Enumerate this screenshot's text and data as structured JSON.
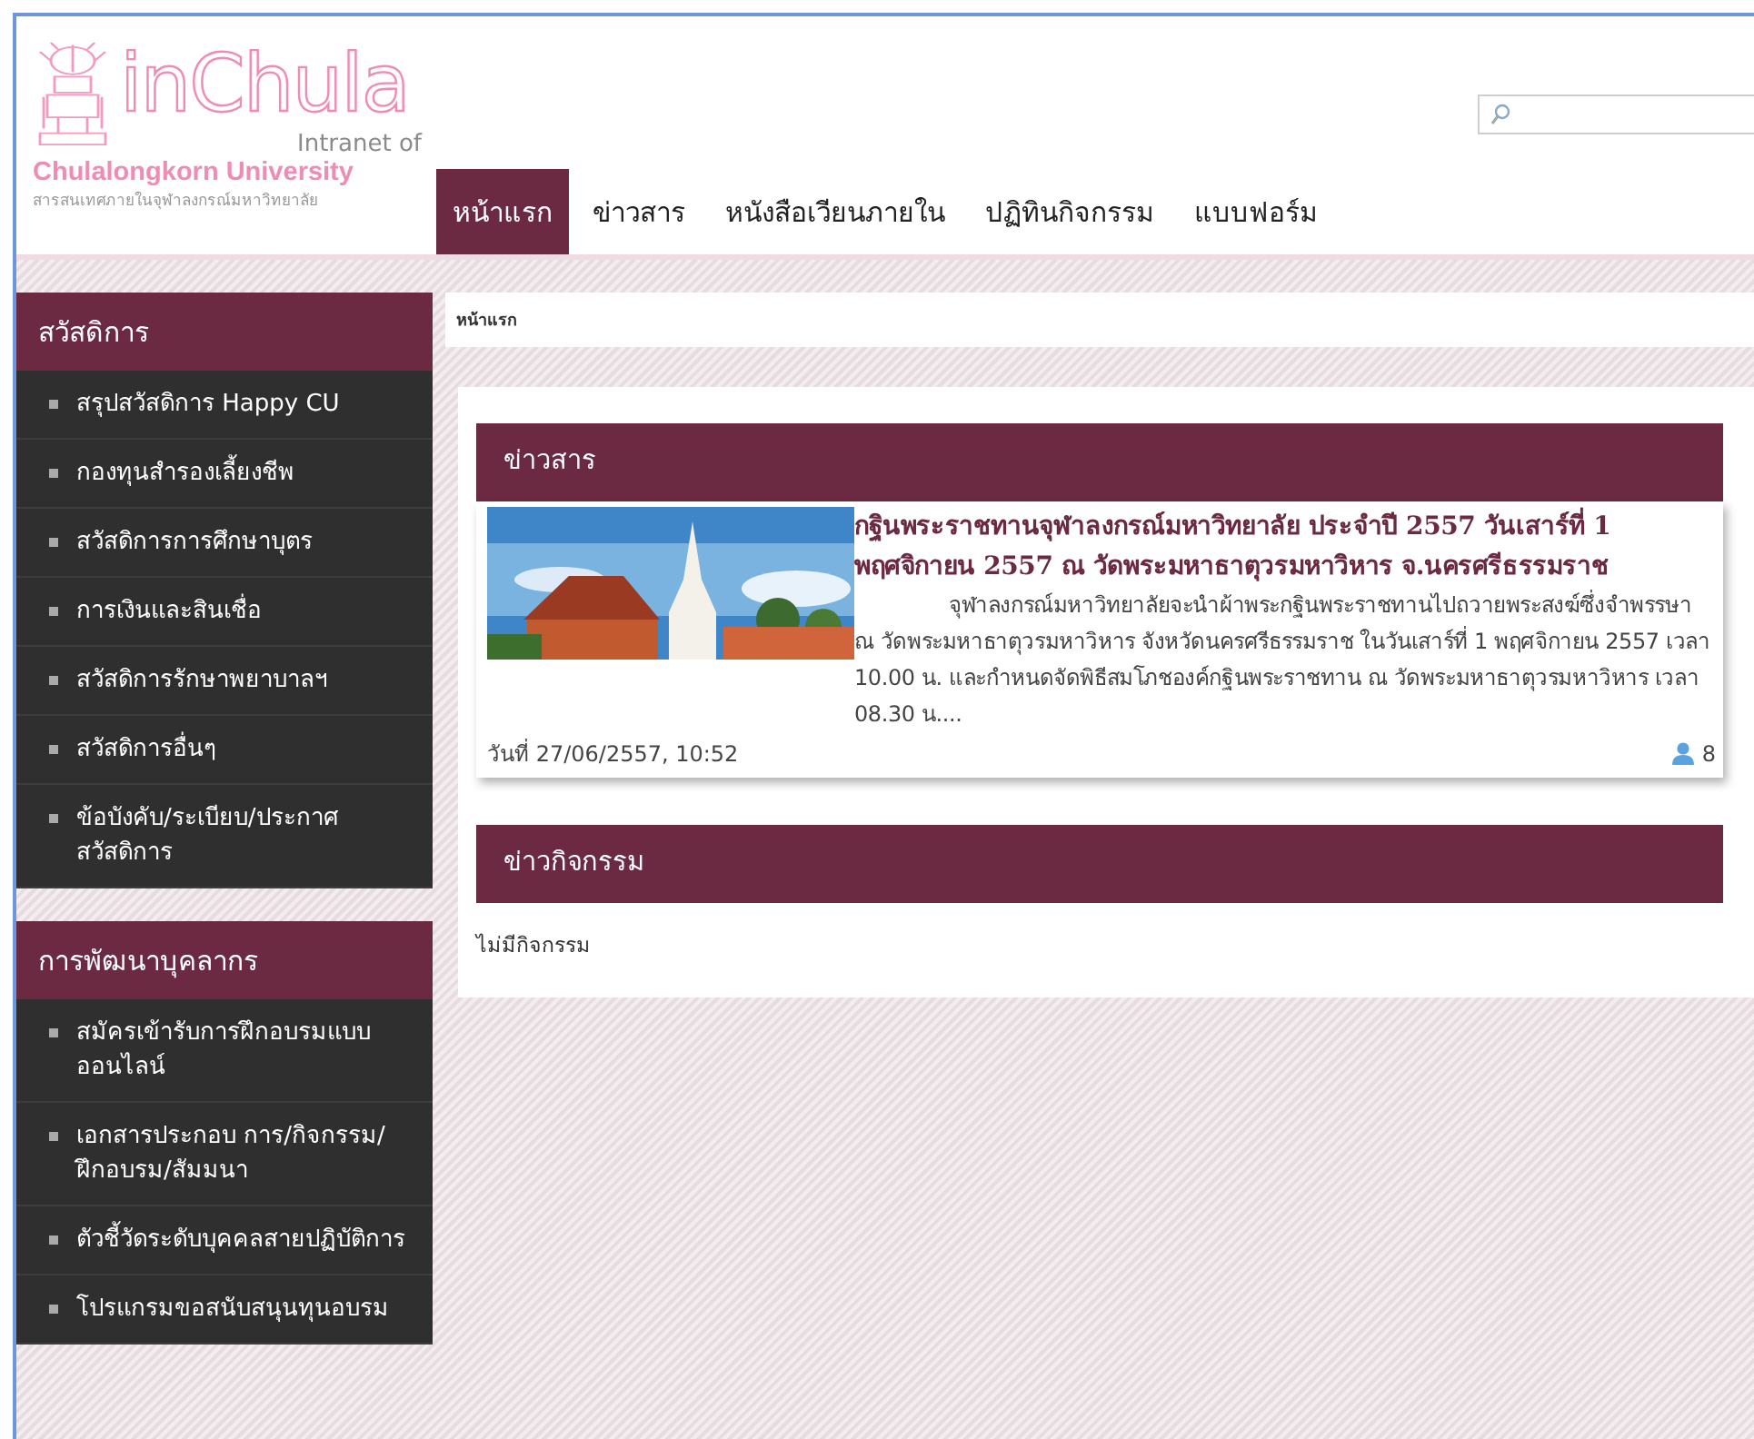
{
  "logo": {
    "title": "inChula",
    "subtitle": "Intranet of",
    "university": "Chulalongkorn University",
    "tagline": "สารสนเทศภายในจุฬาลงกรณ์มหาวิทยาลัย"
  },
  "nav": [
    {
      "label": "หน้าแรก",
      "selected": true
    },
    {
      "label": "ข่าวสาร",
      "selected": false
    },
    {
      "label": "หนังสือเวียนภายใน",
      "selected": false
    },
    {
      "label": "ปฏิทินกิจกรรม",
      "selected": false
    },
    {
      "label": "แบบฟอร์ม",
      "selected": false
    }
  ],
  "sidebar": [
    {
      "title": "สวัสดิการ",
      "items": [
        "สรุปสวัสดิการ Happy CU",
        "กองทุนสำรองเลี้ยงชีพ",
        "สวัสดิการการศึกษาบุตร",
        "การเงินและสินเชื่อ",
        "สวัสดิการรักษาพยาบาลฯ",
        "สวัสดิการอื่นๆ",
        "ข้อบังคับ/ระเบียบ/ประกาศ สวัสดิการ"
      ]
    },
    {
      "title": "การพัฒนาบุคลากร",
      "items": [
        "สมัครเข้ารับการฝึกอบรมแบบออนไลน์",
        "เอกสารประกอบ การ/กิจกรรม/ฝึกอบรม/สัมมนา",
        "ตัวชี้วัดระดับบุคคลสายปฏิบัติการ",
        "โปรแกรมขอสนับสนุนทุนอบรม"
      ]
    }
  ],
  "breadcrumb": "หน้าแรก",
  "sections": [
    {
      "title": "ข่าวสาร",
      "kind": "news",
      "items": [
        {
          "headline": "กฐินพระราชทานจุฬาลงกรณ์มหาวิทยาลัย ประจำปี 2557 วันเสาร์ที่ 1 พฤศจิกายน 2557 ณ วัดพระมหาธาตุวรมหาวิหาร จ.นครศรีธรรมราช",
          "summary": "จุฬาลงกรณ์มหาวิทยาลัยจะนำผ้าพระกฐินพระราชทานไปถวายพระสงฆ์ซึ่งจำพรรษา ณ วัดพระมหาธาตุวรมหาวิหาร จังหวัดนครศรีธรรมราช ในวันเสาร์ที่ 1 พฤศจิกายน 2557 เวลา 10.00 น. และกำหนดจัดพิธีสมโภชองค์กฐินพระราชทาน ณ วัดพระมหาธาตุวรมหาวิหาร เวลา 08.30 น....",
          "date": "วันที่ 27/06/2557, 10:52",
          "views": "8"
        }
      ]
    },
    {
      "title": "ข่าวกิจกรรม",
      "kind": "empty",
      "message": "ไม่มีกิจกรรม"
    }
  ]
}
